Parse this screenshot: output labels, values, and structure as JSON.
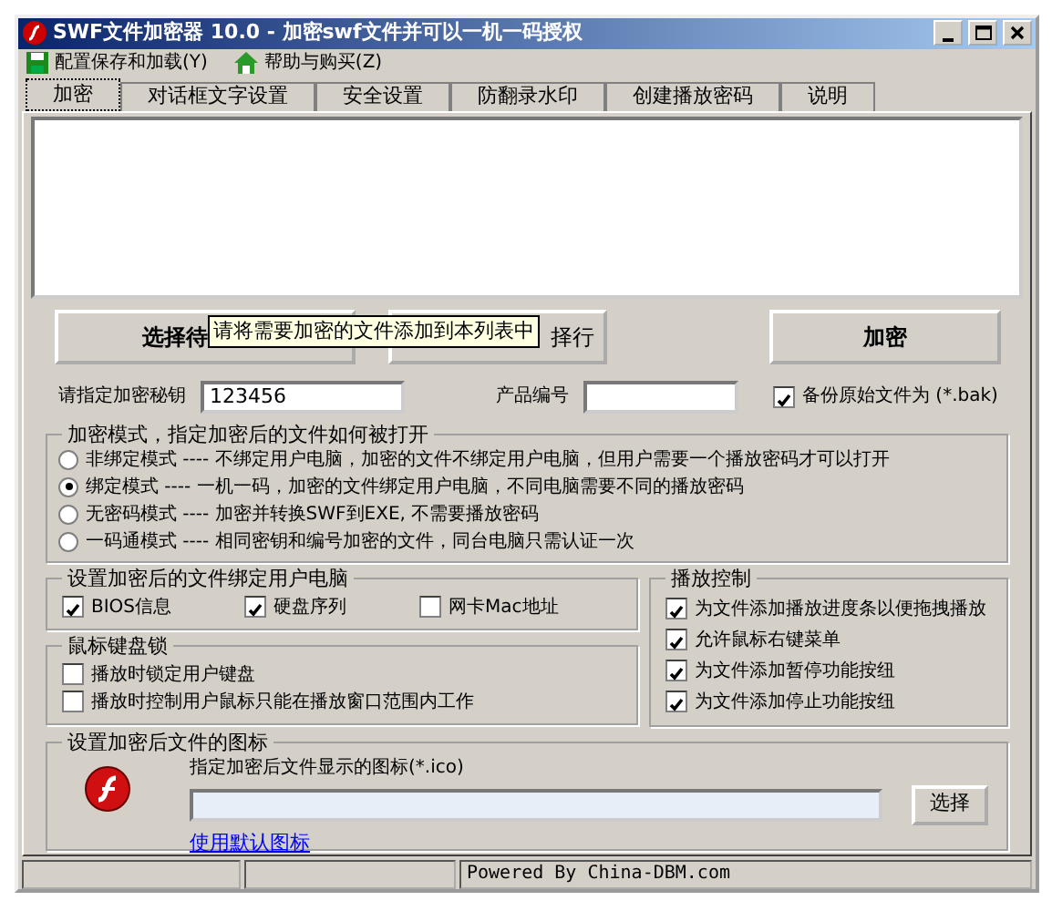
{
  "window": {
    "title": "SWF文件加密器 10.0 - 加密swf文件并可以一机一码授权"
  },
  "menu": [
    {
      "label": "配置保存和加载(Y)",
      "kind": "save"
    },
    {
      "label": "帮助与购买(Z)",
      "kind": "help"
    }
  ],
  "tabs": [
    {
      "label": "加密",
      "selected": true
    },
    {
      "label": "对话框文字设置",
      "selected": false
    },
    {
      "label": "安全设置",
      "selected": false
    },
    {
      "label": "防翻录水印",
      "selected": false
    },
    {
      "label": "创建播放密码",
      "selected": false
    },
    {
      "label": "说明",
      "selected": false
    }
  ],
  "action_buttons": [
    {
      "label": "选择待"
    },
    {
      "label": "择行"
    },
    {
      "label": "加密"
    }
  ],
  "tooltip": "请将需要加密的文件添加到本列表中",
  "key": {
    "label": "请指定加密秘钥",
    "value": "123456"
  },
  "product": {
    "label": "产品编号"
  },
  "backup": {
    "label": "备份原始文件为 (*.bak)",
    "checked": true
  },
  "mode_group": {
    "title": "加密模式，指定加密后的文件如何被打开",
    "options": [
      {
        "label": "非绑定模式 ---- 不绑定用户电脑，加密的文件不绑定用户电脑，但用户需要一个播放密码才可以打开",
        "selected": false
      },
      {
        "label": "绑定模式 ---- 一机一码，加密的文件绑定用户电脑，不同电脑需要不同的播放密码",
        "selected": true
      },
      {
        "label": "无密码模式 ---- 加密并转换SWF到EXE, 不需要播放密码",
        "selected": false
      },
      {
        "label": "一码通模式 ---- 相同密钥和编号加密的文件，同台电脑只需认证一次",
        "selected": false
      }
    ]
  },
  "bind_group": {
    "title": "设置加密后的文件绑定用户电脑",
    "options": [
      {
        "label": "BIOS信息",
        "checked": true
      },
      {
        "label": "硬盘序列",
        "checked": true
      },
      {
        "label": "网卡Mac地址",
        "checked": false
      }
    ]
  },
  "lock_group": {
    "title": "鼠标键盘锁",
    "options": [
      {
        "label": "播放时锁定用户键盘",
        "checked": false
      },
      {
        "label": "播放时控制用户鼠标只能在播放窗口范围内工作",
        "checked": false
      }
    ]
  },
  "play_group": {
    "title": "播放控制",
    "options": [
      {
        "label": "为文件添加播放进度条以便拖拽播放",
        "checked": true
      },
      {
        "label": "允许鼠标右键菜单",
        "checked": true
      },
      {
        "label": "为文件添加暂停功能按纽",
        "checked": true
      },
      {
        "label": "为文件添加停止功能按纽",
        "checked": true
      }
    ]
  },
  "icon_group": {
    "title": "设置加密后文件的图标",
    "hint": "指定加密后文件显示的图标(*.ico)",
    "button": "选择",
    "link": "使用默认图标"
  },
  "status_bar": {
    "text": "Powered By China-DBM.com"
  }
}
